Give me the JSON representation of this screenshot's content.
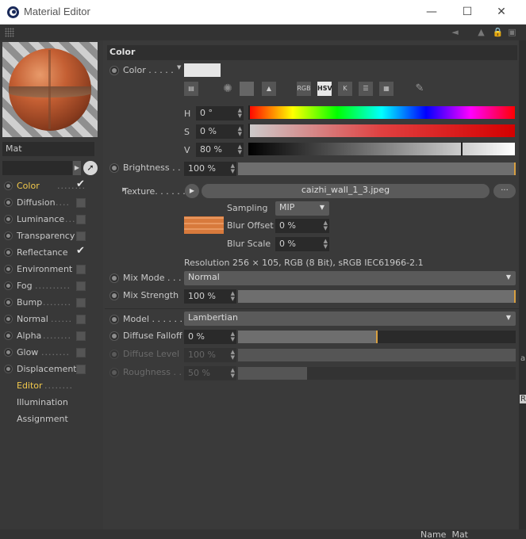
{
  "window": {
    "title": "Material Editor",
    "controls": {
      "minimize": "—",
      "maximize": "☐",
      "close": "✕"
    }
  },
  "left": {
    "material_name": "Mat",
    "channels": [
      {
        "label": "Color",
        "dots": "........",
        "checked": true,
        "active": true
      },
      {
        "label": "Diffusion",
        "dots": "....",
        "checked": false,
        "active": false
      },
      {
        "label": "Luminance",
        "dots": "...",
        "checked": false,
        "active": false
      },
      {
        "label": "Transparency",
        "dots": "",
        "checked": false,
        "active": false
      },
      {
        "label": "Reflectance",
        "dots": "",
        "checked": true,
        "active": false
      },
      {
        "label": "Environment",
        "dots": "",
        "checked": false,
        "active": false
      },
      {
        "label": "Fog",
        "dots": "..........",
        "checked": false,
        "active": false
      },
      {
        "label": "Bump",
        "dots": "........",
        "checked": false,
        "active": false
      },
      {
        "label": "Normal",
        "dots": "......",
        "checked": false,
        "active": false
      },
      {
        "label": "Alpha",
        "dots": "........",
        "checked": false,
        "active": false
      },
      {
        "label": "Glow",
        "dots": "........",
        "checked": false,
        "active": false
      },
      {
        "label": "Displacement",
        "dots": "",
        "checked": false,
        "active": false
      }
    ],
    "extra_items": [
      {
        "label": "Editor",
        "dots": "........",
        "active": true
      },
      {
        "label": "Illumination",
        "dots": "",
        "active": false
      },
      {
        "label": "Assignment",
        "dots": "",
        "active": false
      }
    ]
  },
  "main": {
    "section_title": "Color",
    "color_label": "Color . . . . .",
    "icons": [
      "RGB",
      "HSV",
      "K"
    ],
    "h": {
      "label": "H",
      "value": "0 °",
      "fraction": 0.0
    },
    "s": {
      "label": "S",
      "value": "0 %",
      "fraction": 0.0
    },
    "v": {
      "label": "V",
      "value": "80 %",
      "fraction": 0.8
    },
    "brightness": {
      "label": "Brightness . . .",
      "value": "100 %",
      "fraction": 1.0
    },
    "texture": {
      "label": "Texture. . . . . .",
      "file": "caizhi_wall_1_3.jpeg",
      "more": "...",
      "sampling_label": "Sampling",
      "sampling_value": "MIP",
      "blur_offset_label": "Blur Offset",
      "blur_offset_value": "0 %",
      "blur_scale_label": "Blur Scale",
      "blur_scale_value": "0 %",
      "resolution": "Resolution 256 × 105, RGB (8 Bit), sRGB IEC61966-2.1"
    },
    "mix_mode": {
      "label": "Mix Mode . . .",
      "value": "Normal"
    },
    "mix_strength": {
      "label": "Mix Strength",
      "value": "100 %",
      "fraction": 1.0
    },
    "model": {
      "label": "Model . . . . . . .",
      "value": "Lambertian"
    },
    "diffuse_falloff": {
      "label": "Diffuse Falloff",
      "value": "0 %",
      "fraction": 0.5
    },
    "diffuse_level": {
      "label": "Diffuse Level",
      "value": "100 %",
      "fraction": 1.0
    },
    "roughness": {
      "label": "Roughness . . .",
      "value": "50 %",
      "fraction": 0.25
    }
  },
  "edge": {
    "top_char": "a",
    "bottom_char": "R"
  },
  "bottom": {
    "name_label": "Name",
    "name_value": "Mat"
  }
}
